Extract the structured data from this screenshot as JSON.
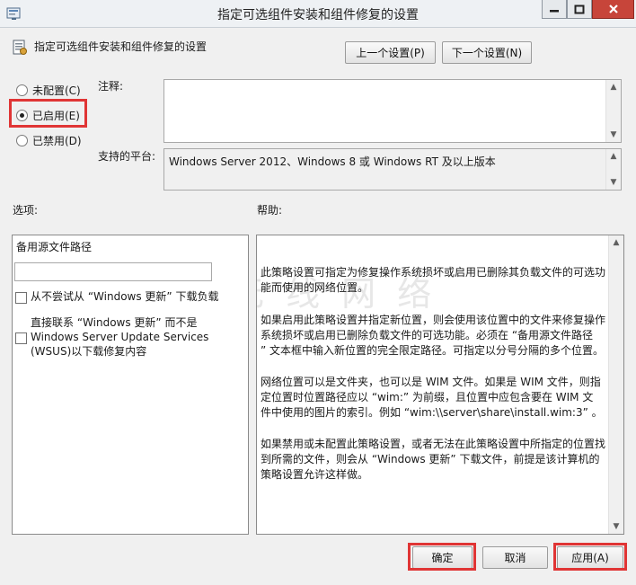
{
  "window": {
    "title": "指定可选组件安装和组件修复的设置",
    "controls": {
      "minimize": "—",
      "maximize": "□",
      "close": "✕"
    }
  },
  "header": {
    "text": "指定可选组件安装和组件修复的设置"
  },
  "nav": {
    "prev_label": "上一个设置(P)",
    "next_label": "下一个设置(N)"
  },
  "state": {
    "options": [
      {
        "label": "未配置(C)",
        "checked": false
      },
      {
        "label": "已启用(E)",
        "checked": true
      },
      {
        "label": "已禁用(D)",
        "checked": false
      }
    ]
  },
  "comment": {
    "label": "注释:",
    "value": ""
  },
  "platform": {
    "label": "支持的平台:",
    "value": "Windows Server 2012、Windows 8 或 Windows RT 及以上版本"
  },
  "options_panel": {
    "title": "选项:",
    "path_label": "备用源文件路径",
    "path_value": "",
    "check1_label": "从不尝试从 “Windows 更新” 下载负载",
    "check2_lines": [
      "直接联系 “Windows 更新” 而不是",
      "Windows Server Update Services",
      "(WSUS)以下载修复内容"
    ]
  },
  "help_panel": {
    "title": "帮助:",
    "paragraphs": [
      [
        "此策略设置可指定为修复操作系统损坏或启用已删除其负载文件的可选功",
        "能而使用的网络位置。"
      ],
      [
        "如果启用此策略设置并指定新位置，则会使用该位置中的文件来修复操作",
        "系统损坏或启用已删除负载文件的可选功能。必须在 “备用源文件路径",
        "” 文本框中输入新位置的完全限定路径。可指定以分号分隔的多个位置。"
      ],
      [
        "网络位置可以是文件夹，也可以是 WIM 文件。如果是 WIM 文件，则指",
        "定位置时位置路径应以 “wim:” 为前缀，且位置中应包含要在 WIM 文",
        "件中使用的图片的索引。例如 “wim:\\\\server\\share\\install.wim:3” 。"
      ],
      [
        "如果禁用或未配置此策略设置，或者无法在此策略设置中所指定的位置找",
        "到所需的文件，则会从 “Windows 更新” 下载文件，前提是该计算机的",
        "策略设置允许这样做。"
      ]
    ],
    "watermark": "无 线 网 络"
  },
  "buttons": {
    "ok": "确定",
    "cancel": "取消",
    "apply": "应用(A)"
  },
  "colors": {
    "highlight": "#e03535",
    "close_button": "#c7453a"
  }
}
